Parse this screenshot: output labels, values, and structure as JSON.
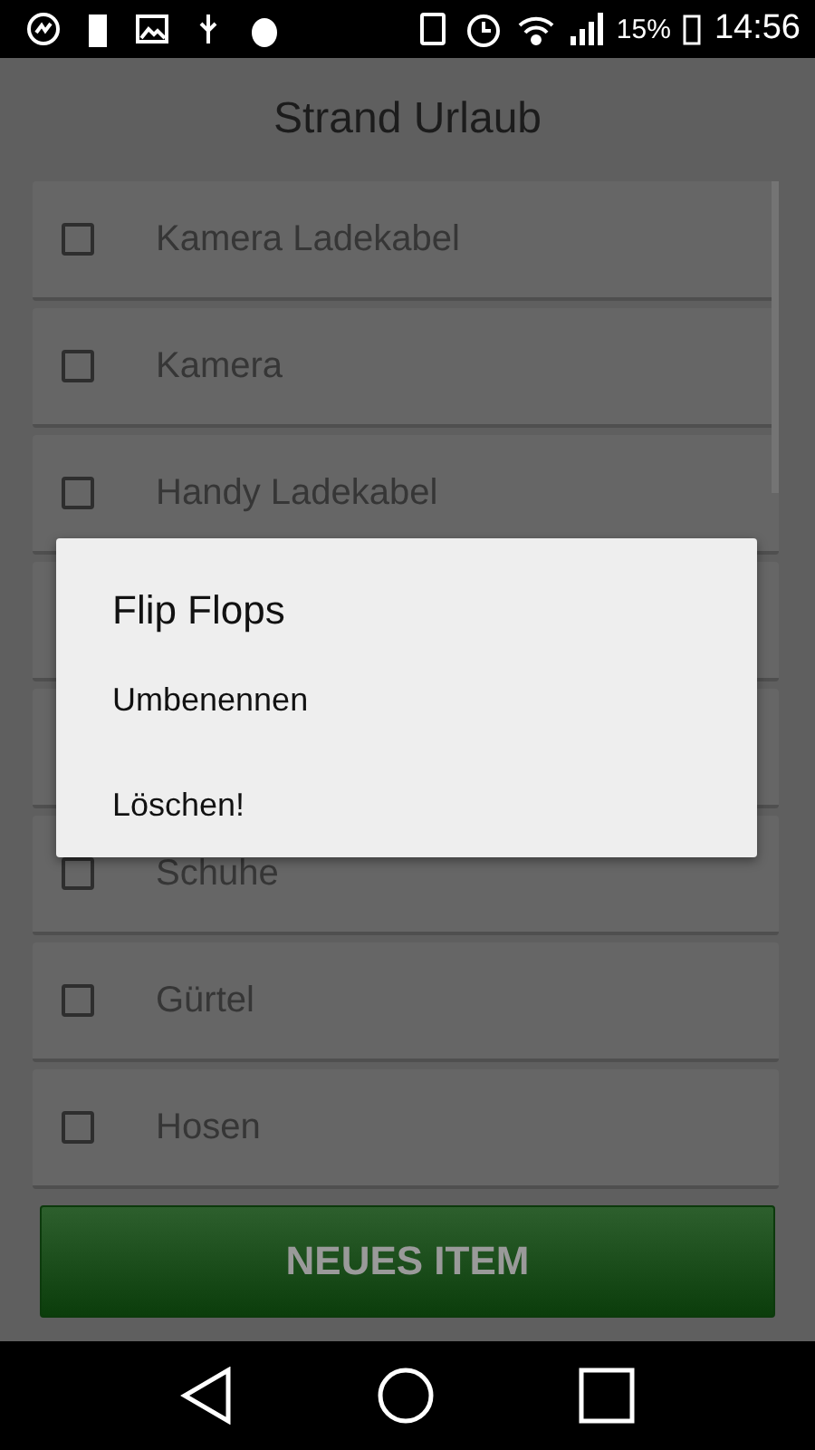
{
  "status_bar": {
    "battery_percent": "15%",
    "time": "14:56"
  },
  "title": "Strand Urlaub",
  "items": [
    {
      "kind": "checkbox",
      "label": "Kamera Ladekabel",
      "checked": false
    },
    {
      "kind": "checkbox",
      "label": "Kamera",
      "checked": false
    },
    {
      "kind": "checkbox",
      "label": "Handy Ladekabel",
      "checked": false
    },
    {
      "kind": "covered"
    },
    {
      "kind": "covered"
    },
    {
      "kind": "checkbox",
      "label": "Schuhe",
      "checked": false
    },
    {
      "kind": "checkbox",
      "label": "Gürtel",
      "checked": false
    },
    {
      "kind": "checkbox",
      "label": "Hosen",
      "checked": false
    }
  ],
  "add_button": "NEUES ITEM",
  "dialog": {
    "title": "Flip Flops",
    "options": [
      "Umbenennen",
      "Löschen!"
    ]
  }
}
